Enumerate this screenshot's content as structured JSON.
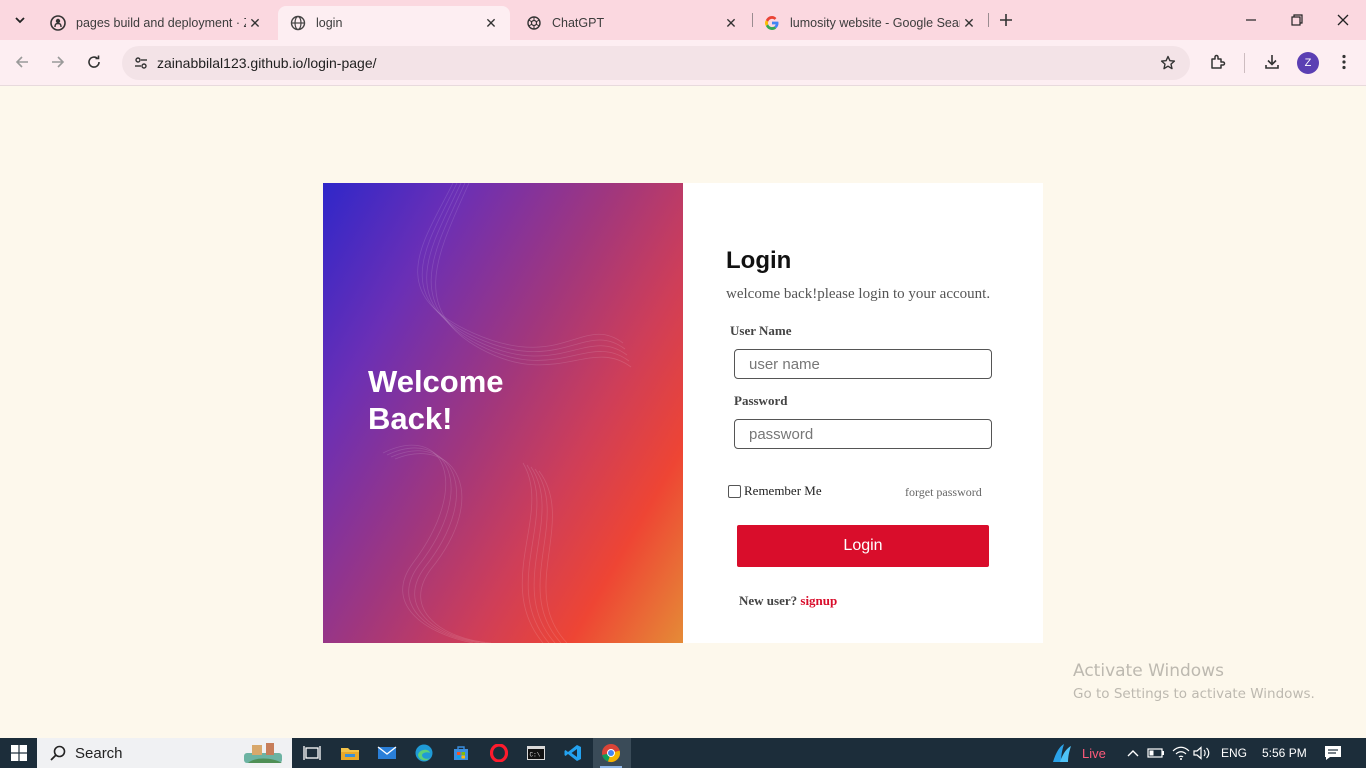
{
  "browser": {
    "tabs": [
      {
        "title": "pages build and deployment · Z",
        "icon": "github-icon",
        "active": false
      },
      {
        "title": "login",
        "icon": "globe-icon",
        "active": true
      },
      {
        "title": "ChatGPT",
        "icon": "chatgpt-icon",
        "active": false
      },
      {
        "title": "lumosity website - Google Sear",
        "icon": "google-icon",
        "active": false
      }
    ],
    "url": "zainabbilal123.github.io/login-page/",
    "profile_initial": "Z"
  },
  "hero": {
    "title": "Welcome Back!"
  },
  "login": {
    "heading": "Login",
    "subtitle": "welcome back!please login to your account.",
    "username_label": "User Name",
    "username_placeholder": "user name",
    "password_label": "Password",
    "password_placeholder": "password",
    "remember_label": "Remember Me",
    "forget_label": "forget password",
    "button_label": "Login",
    "new_user_text": "New user?",
    "signup_label": "signup"
  },
  "watermark": {
    "line1": "Activate Windows",
    "line2": "Go to Settings to activate Windows."
  },
  "taskbar": {
    "search_label": "Search",
    "live_label": "Live",
    "language": "ENG",
    "time": "5:56 PM"
  },
  "colors": {
    "accent": "#d90d2b",
    "page_bg": "#fdf8ec",
    "tabstrip_bg": "#fbd8e0"
  }
}
